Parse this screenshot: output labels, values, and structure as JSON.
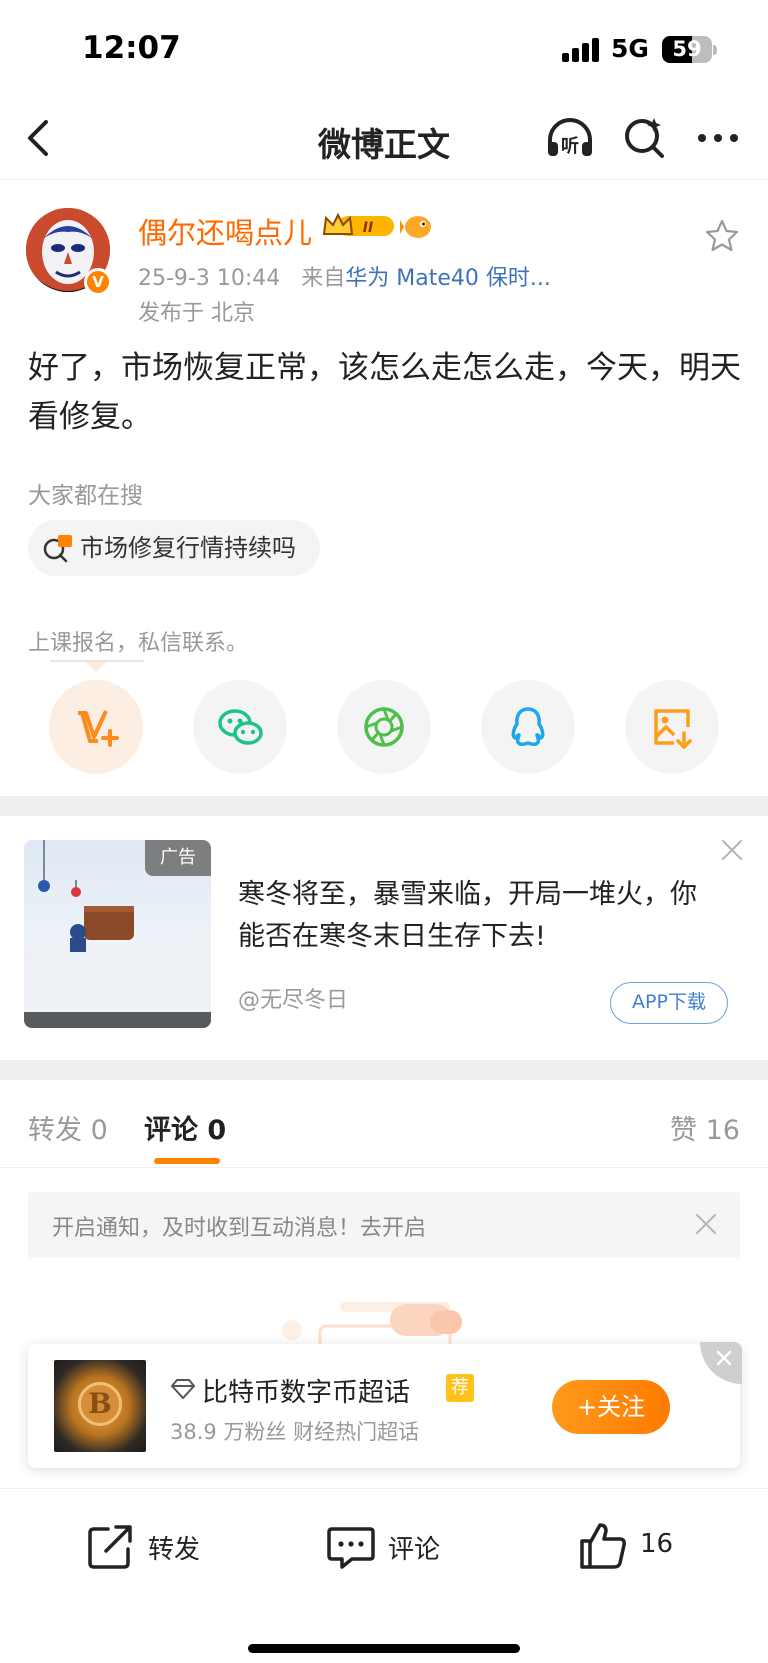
{
  "status_bar": {
    "time": "12:07",
    "network": "5G",
    "battery": "59"
  },
  "nav": {
    "title": "微博正文",
    "listen_label": "听"
  },
  "post": {
    "username": "偶尔还喝点儿",
    "level_badge": "II",
    "timestamp": "25-9-3 10:44",
    "source_prefix": "来自",
    "source": "华为 Mate40 保时...",
    "location": "发布于 北京",
    "text": "好了，市场恢复正常，该怎么走怎么走，今天，明天看修复。",
    "hot_search_label": "大家都在搜",
    "hot_search_query": "市场修复行情持续吗",
    "course_note": "上课报名，私信联系。"
  },
  "share_targets": [
    "weibo-vplus",
    "wechat",
    "moments",
    "qq",
    "save-image"
  ],
  "ad": {
    "tag": "广告",
    "title": "寒冬将至，暴雪来临，开局一堆火，你能否在寒冬末日生存下去!",
    "source": "@无尽冬日",
    "button": "APP下载"
  },
  "tabs": {
    "repost_label": "转发",
    "repost_count": "0",
    "comment_label": "评论",
    "comment_count": "0",
    "like_label": "赞",
    "like_count": "16"
  },
  "notify": {
    "text": "开启通知，及时收到互动消息！去开启"
  },
  "follow_card": {
    "name": "比特币数字币超话",
    "tag": "荐",
    "sub": "38.9 万粉丝  财经热门超话",
    "button": "+关注"
  },
  "bottom_bar": {
    "repost": "转发",
    "comment": "评论",
    "like": "16"
  },
  "colors": {
    "accent": "#ff8200",
    "username": "#ff6a00",
    "link": "#3f73b8"
  }
}
